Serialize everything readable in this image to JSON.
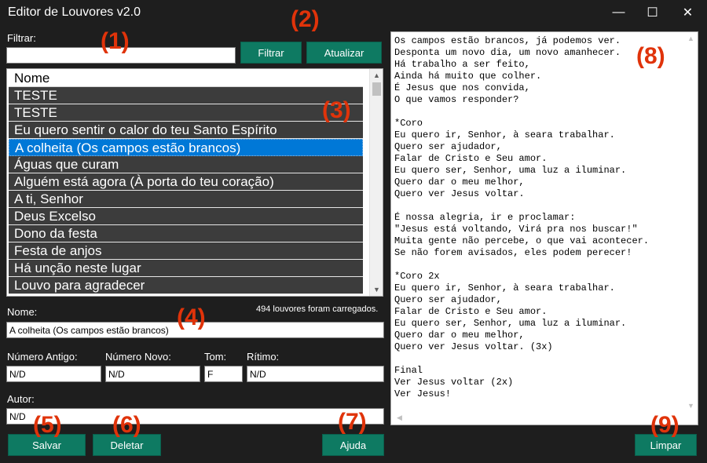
{
  "window": {
    "title": "Editor de Louvores v2.0",
    "minimize_glyph": "—",
    "maximize_glyph": "☐",
    "close_glyph": "✕"
  },
  "filter": {
    "label": "Filtrar:",
    "value": "",
    "filter_button": "Filtrar",
    "refresh_button": "Atualizar"
  },
  "song_list": {
    "header": "Nome",
    "items": [
      "TESTE",
      "TESTE",
      "Eu quero sentir o calor do teu Santo Espírito",
      "A colheita (Os campos estão brancos)",
      "Águas que curam",
      "Alguém está agora (À porta do teu coração)",
      "A ti, Senhor",
      "Deus Excelso",
      "Dono da festa",
      "Festa de anjos",
      "Há unção neste lugar",
      "Louvo para agradecer"
    ],
    "selected_index": 3,
    "loaded_message": "494 louvores foram carregados."
  },
  "form": {
    "name_label": "Nome:",
    "name_value": "A colheita (Os campos estão brancos)",
    "old_number_label": "Número Antigo:",
    "old_number_value": "N/D",
    "new_number_label": "Número Novo:",
    "new_number_value": "N/D",
    "key_label": "Tom:",
    "key_value": "F",
    "rhythm_label": "Rítimo:",
    "rhythm_value": "N/D",
    "author_label": "Autor:",
    "author_value": "N/D"
  },
  "buttons": {
    "save": "Salvar",
    "delete": "Deletar",
    "help": "Ajuda",
    "clear": "Limpar"
  },
  "lyrics": {
    "text": "Os campos estão brancos, já podemos ver.\nDesponta um novo dia, um novo amanhecer.\nHá trabalho a ser feito,\nAinda há muito que colher.\nÉ Jesus que nos convida,\nO que vamos responder?\n\n*Coro\nEu quero ir, Senhor, à seara trabalhar.\nQuero ser ajudador,\nFalar de Cristo e Seu amor.\nEu quero ser, Senhor, uma luz a iluminar.\nQuero dar o meu melhor,\nQuero ver Jesus voltar.\n\nÉ nossa alegria, ir e proclamar:\n\"Jesus está voltando, Virá pra nos buscar!\"\nMuita gente não percebe, o que vai acontecer.\nSe não forem avisados, eles podem perecer!\n\n*Coro 2x\nEu quero ir, Senhor, à seara trabalhar.\nQuero ser ajudador,\nFalar de Cristo e Seu amor.\nEu quero ser, Senhor, uma luz a iluminar.\nQuero dar o meu melhor,\nQuero ver Jesus voltar. (3x)\n\nFinal\nVer Jesus voltar (2x)\nVer Jesus!"
  },
  "annotations": {
    "m1": "(1)",
    "m2": "(2)",
    "m3": "(3)",
    "m4": "(4)",
    "m5": "(5)",
    "m6": "(6)",
    "m7": "(7)",
    "m8": "(8)",
    "m9": "(9)"
  },
  "colors": {
    "background": "#1e1e1e",
    "button": "#0e7a62",
    "list_row": "#3c3c3c",
    "selected_row": "#0078d7",
    "annotation": "#e0330a"
  }
}
